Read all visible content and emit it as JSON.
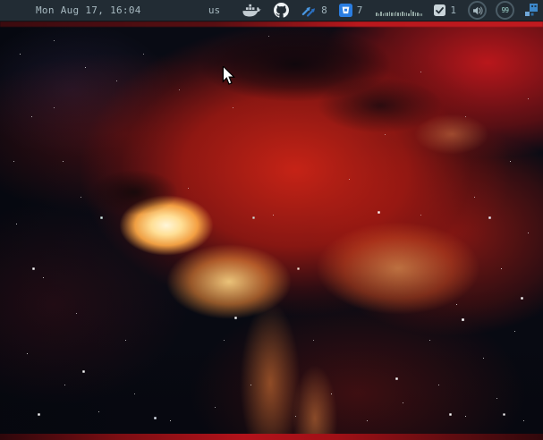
{
  "colors": {
    "panel_bg": "#222c34",
    "panel_text": "#a7b9c0",
    "accent_blue": "#2f82d6",
    "icon_gray": "#c3ccd2",
    "battery_text": "#9fd3cb",
    "nebula_red": "#c01b20",
    "nebula_core": "#fff6d8"
  },
  "panel": {
    "clock": "Mon Aug 17, 16:04",
    "keyboard_layout": "us",
    "tray": {
      "docker": {
        "icon": "docker-whale-icon"
      },
      "github": {
        "icon": "github-octocat-icon"
      },
      "git_arrows": {
        "icon": "double-up-right-arrows-icon",
        "count": "8"
      },
      "bitbucket": {
        "icon": "bitbucket-bucket-icon",
        "count": "7"
      },
      "system_monitor": {
        "icon": "histogram-bars",
        "bars": [
          4,
          3,
          5,
          3,
          4,
          4,
          5,
          4,
          4,
          5,
          4,
          4,
          5,
          4,
          4,
          3,
          7,
          5,
          4,
          4,
          3,
          3
        ]
      },
      "tasks": {
        "icon": "checked-checkbox-icon",
        "count": "1"
      },
      "volume": {
        "icon": "speaker-in-circle-icon"
      },
      "battery": {
        "icon": "circle-gauge-icon",
        "value": "99"
      },
      "app_squares": {
        "icon": "blue-squares-icon"
      }
    }
  },
  "desktop": {
    "wallpaper": "red-orange-nebula-starfield",
    "cursor": "arrow-pointer"
  }
}
